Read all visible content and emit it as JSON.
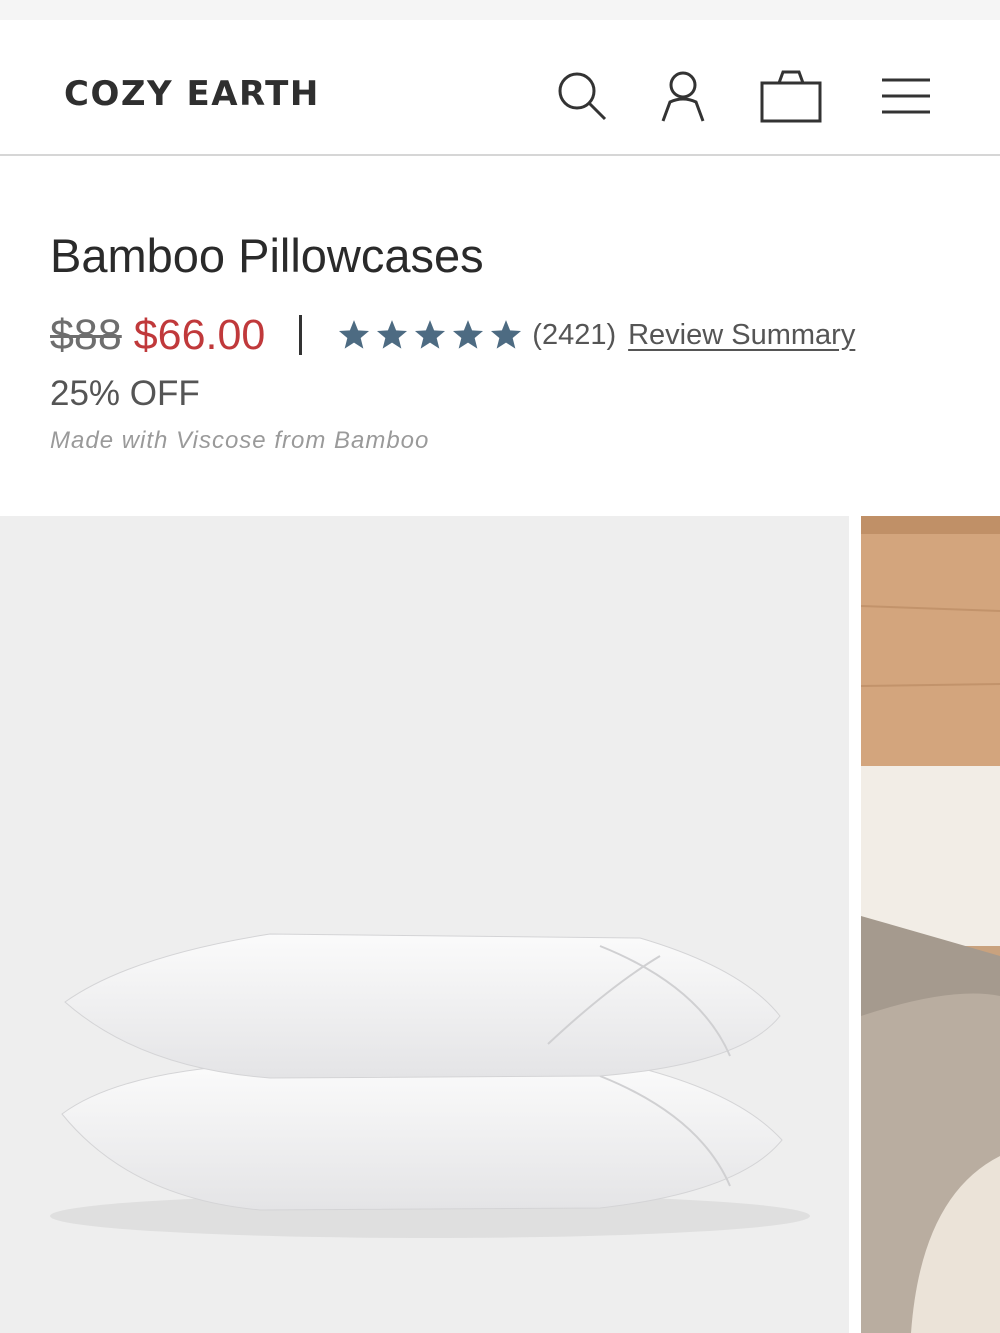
{
  "header": {
    "brand": "COZY EARTH",
    "icons": [
      "search-icon",
      "account-icon",
      "bag-icon",
      "menu-icon"
    ]
  },
  "product": {
    "title": "Bamboo Pillowcases",
    "original_price": "$88",
    "sale_price": "$66.00",
    "rating": 5,
    "review_count": "(2421)",
    "review_link": "Review Summary",
    "discount": "25% OFF",
    "material": "Made with Viscose from Bamboo"
  },
  "colors": {
    "sale_price": "#c0393b",
    "stars": "#4d6b82",
    "image_background": "#eeeeee"
  }
}
